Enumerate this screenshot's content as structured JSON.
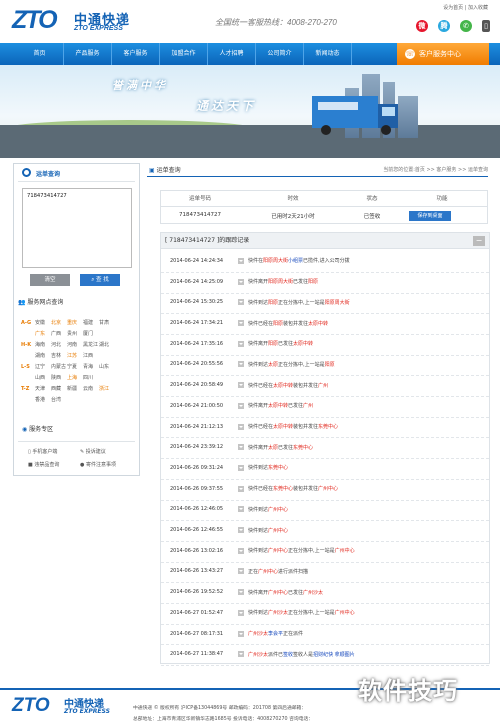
{
  "header": {
    "logo_mark": "ZTO",
    "logo_cn": "中通快递",
    "logo_en": "ZTO EXPRESS",
    "hotline": "全国统一客服热线：4008-270-270",
    "top_links": "设为首页 | 加入收藏",
    "social": [
      "weibo-icon",
      "tencent-weibo-icon",
      "wechat-icon",
      "mobile-icon"
    ]
  },
  "nav": {
    "items": [
      "首页",
      "产品服务",
      "客户服务",
      "加盟合作",
      "人才招聘",
      "公司简介",
      "新闻动态"
    ],
    "service_button": "客户服务中心"
  },
  "banner": {
    "slogan1": "誉满中华",
    "slogan2": "通达天下"
  },
  "sidebar": {
    "query_title": "运单查询",
    "waybill": "718473414727",
    "clear_button": "清空",
    "query_button": "查 找",
    "network_title": "服务网点查询",
    "regions": [
      {
        "label": "A-G",
        "cities": [
          "安徽",
          "北京",
          "重庆",
          "福建",
          "甘肃"
        ]
      },
      {
        "label": "",
        "cities": [
          "广东",
          "广西",
          "贵州",
          "厦门"
        ]
      },
      {
        "label": "H-K",
        "cities": [
          "海南",
          "河北",
          "河南",
          "黑龙江",
          "湖北"
        ]
      },
      {
        "label": "",
        "cities": [
          "湖南",
          "吉林",
          "江苏",
          "江西"
        ]
      },
      {
        "label": "L-S",
        "cities": [
          "辽宁",
          "内蒙古",
          "宁夏",
          "青海",
          "山东"
        ]
      },
      {
        "label": "",
        "cities": [
          "山西",
          "陕西",
          "上海",
          "四川"
        ]
      },
      {
        "label": "T-Z",
        "cities": [
          "天津",
          "西藏",
          "新疆",
          "云南",
          "浙江"
        ]
      },
      {
        "label": "",
        "cities": [
          "香港",
          "台湾"
        ]
      }
    ],
    "service_title": "服务专区",
    "service_links": [
      "手机客户端",
      "投诉建议",
      "违禁品查询",
      "寄件注意事项"
    ]
  },
  "content": {
    "section_title": "运单查询",
    "breadcrumb": "当前您的位置:首页 >> 客户服务 >> 运单查询",
    "result_headers": [
      "运单号码",
      "时效",
      "状态",
      "功能"
    ],
    "result_values": [
      "718473414727",
      "已用时2天21小时",
      "已签收",
      "保存到桌面"
    ],
    "track_title": "[ 718473414727 ]的跟踪记录",
    "track": [
      {
        "time": "2014-06-24 14:24:34",
        "text": [
          [
            "",
            "快件在"
          ],
          [
            "red",
            "阳原周大街"
          ],
          [
            "blu",
            "小组票"
          ],
          [
            "",
            "已揽件,进入公司分拨"
          ]
        ]
      },
      {
        "time": "2014-06-24 14:25:09",
        "text": [
          [
            "",
            "快件离开"
          ],
          [
            "red",
            "阳原周大街"
          ],
          [
            "",
            "已发往"
          ],
          [
            "red",
            "阳原"
          ]
        ]
      },
      {
        "time": "2014-06-24 15:30:25",
        "text": [
          [
            "",
            "快件到达"
          ],
          [
            "red",
            "阳原"
          ],
          [
            "",
            "正在分拣中,上一站是"
          ],
          [
            "red",
            "阳原周大街"
          ]
        ]
      },
      {
        "time": "2014-06-24 17:34:21",
        "text": [
          [
            "",
            "快件已经在"
          ],
          [
            "red",
            "阳原"
          ],
          [
            "",
            "装包并发往"
          ],
          [
            "red",
            "太原中转"
          ]
        ]
      },
      {
        "time": "2014-06-24 17:35:16",
        "text": [
          [
            "",
            "快件离开"
          ],
          [
            "red",
            "阳原"
          ],
          [
            "",
            "已发往"
          ],
          [
            "red",
            "太原中转"
          ]
        ]
      },
      {
        "time": "2014-06-24 20:55:56",
        "text": [
          [
            "",
            "快件到达"
          ],
          [
            "red",
            "太原"
          ],
          [
            "",
            "正在分拣中,上一站是"
          ],
          [
            "red",
            "阳原"
          ]
        ]
      },
      {
        "time": "2014-06-24 20:58:49",
        "text": [
          [
            "",
            "快件已经在"
          ],
          [
            "red",
            "太原中转"
          ],
          [
            "",
            "装包并发往"
          ],
          [
            "red",
            "广州"
          ]
        ]
      },
      {
        "time": "2014-06-24 21:00:50",
        "text": [
          [
            "",
            "快件离开"
          ],
          [
            "red",
            "太原中转"
          ],
          [
            "",
            "已发往"
          ],
          [
            "red",
            "广州"
          ]
        ]
      },
      {
        "time": "2014-06-24 21:12:13",
        "text": [
          [
            "",
            "快件已经在"
          ],
          [
            "red",
            "太原中转"
          ],
          [
            "",
            "装包并发往"
          ],
          [
            "red",
            "东莞中心"
          ]
        ]
      },
      {
        "time": "2014-06-24 23:39:12",
        "text": [
          [
            "",
            "快件离开"
          ],
          [
            "red",
            "太原"
          ],
          [
            "",
            "已发往"
          ],
          [
            "red",
            "东莞中心"
          ]
        ]
      },
      {
        "time": "2014-06-26 09:31:24",
        "text": [
          [
            "",
            "快件到达"
          ],
          [
            "red",
            "东莞中心"
          ]
        ]
      },
      {
        "time": "2014-06-26 09:37:55",
        "text": [
          [
            "",
            "快件已经在"
          ],
          [
            "red",
            "东莞中心"
          ],
          [
            "",
            "装包并发往"
          ],
          [
            "red",
            "广州中心"
          ]
        ]
      },
      {
        "time": "2014-06-26 12:46:05",
        "text": [
          [
            "",
            "快件到达"
          ],
          [
            "red",
            "广州中心"
          ]
        ]
      },
      {
        "time": "2014-06-26 12:46:55",
        "text": [
          [
            "",
            "快件到达"
          ],
          [
            "red",
            "广州中心"
          ]
        ]
      },
      {
        "time": "2014-06-26 13:02:16",
        "text": [
          [
            "",
            "快件到达"
          ],
          [
            "red",
            "广州中心"
          ],
          [
            "",
            "正在分拣中,上一站是"
          ],
          [
            "red",
            "广州中心"
          ]
        ]
      },
      {
        "time": "2014-06-26 13:43:27",
        "text": [
          [
            "",
            "正在"
          ],
          [
            "red",
            "广州中心"
          ],
          [
            "",
            "进行派件扫描"
          ]
        ]
      },
      {
        "time": "2014-06-26 19:52:52",
        "text": [
          [
            "",
            "快件离开"
          ],
          [
            "red",
            "广州中心"
          ],
          [
            "",
            "已发往"
          ],
          [
            "red",
            "广州沙太"
          ]
        ]
      },
      {
        "time": "2014-06-27 01:52:47",
        "text": [
          [
            "",
            "快件到达"
          ],
          [
            "red",
            "广州沙太"
          ],
          [
            "",
            "正在分拣中,上一站是"
          ],
          [
            "red",
            "广州中心"
          ]
        ]
      },
      {
        "time": "2014-06-27 08:17:31",
        "text": [
          [
            "red",
            "广州沙太"
          ],
          [
            "blu",
            "李会平"
          ],
          [
            "",
            "正在派件"
          ]
        ]
      },
      {
        "time": "2014-06-27 11:38:47",
        "text": [
          [
            "red",
            "广州沙太"
          ],
          [
            "",
            "派件已"
          ],
          [
            "blu",
            "签收"
          ],
          [
            "",
            "签收人是"
          ],
          [
            "blu",
            "招财纪快 拿顺图片"
          ]
        ]
      }
    ]
  },
  "footer": {
    "logo_mark": "ZTO",
    "logo_cn": "中通快递",
    "logo_en": "ZTO EXPRESS",
    "line1": "中通快递 © 版权所有 沪ICP备13044869号 邮政编码：201708 第四后通邮箱：",
    "line2": "总部地址：上海市青浦区华新镇华志路1685号 投诉电话：4008270270 咨询电话："
  },
  "watermark": "软件技巧",
  "colors": {
    "brand_blue": "#1463b5",
    "nav_orange": "#f07c00",
    "accent_red": "#e1251b"
  }
}
